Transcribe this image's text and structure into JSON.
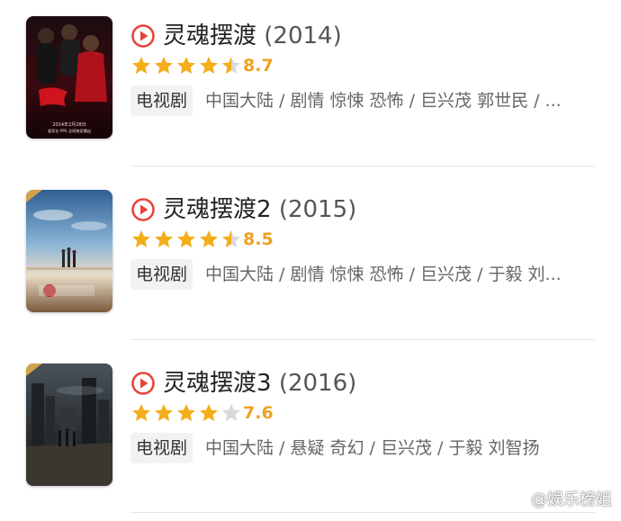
{
  "items": [
    {
      "title": "灵魂摆渡",
      "year": "(2014)",
      "rating": 4.5,
      "score": "8.7",
      "type_tag": "电视剧",
      "meta": "中国大陆 / 剧情 惊悚 恐怖 / 巨兴茂 郭世民 / ...",
      "poster_caption_1": "2014年2月28日",
      "poster_caption_2": "爱奇艺 PPS 全网独家播出"
    },
    {
      "title": "灵魂摆渡2",
      "year": "(2015)",
      "rating": 4.5,
      "score": "8.5",
      "type_tag": "电视剧",
      "meta": "中国大陆 / 剧情 惊悚 恐怖 / 巨兴茂 / 于毅 刘...",
      "poster_caption_1": "",
      "poster_caption_2": ""
    },
    {
      "title": "灵魂摆渡3",
      "year": "(2016)",
      "rating": 4,
      "score": "7.6",
      "type_tag": "电视剧",
      "meta": "中国大陆 / 悬疑 奇幻 / 巨兴茂 / 于毅 刘智扬",
      "poster_caption_1": "",
      "poster_caption_2": ""
    }
  ],
  "watermark": {
    "text": "@娱乐榜姐",
    "icon": "weibo-icon"
  },
  "colors": {
    "play_red": "#e8443a",
    "star_gold": "#f4ad1b",
    "star_empty": "#d9d9d9",
    "score": "#f0a020"
  }
}
